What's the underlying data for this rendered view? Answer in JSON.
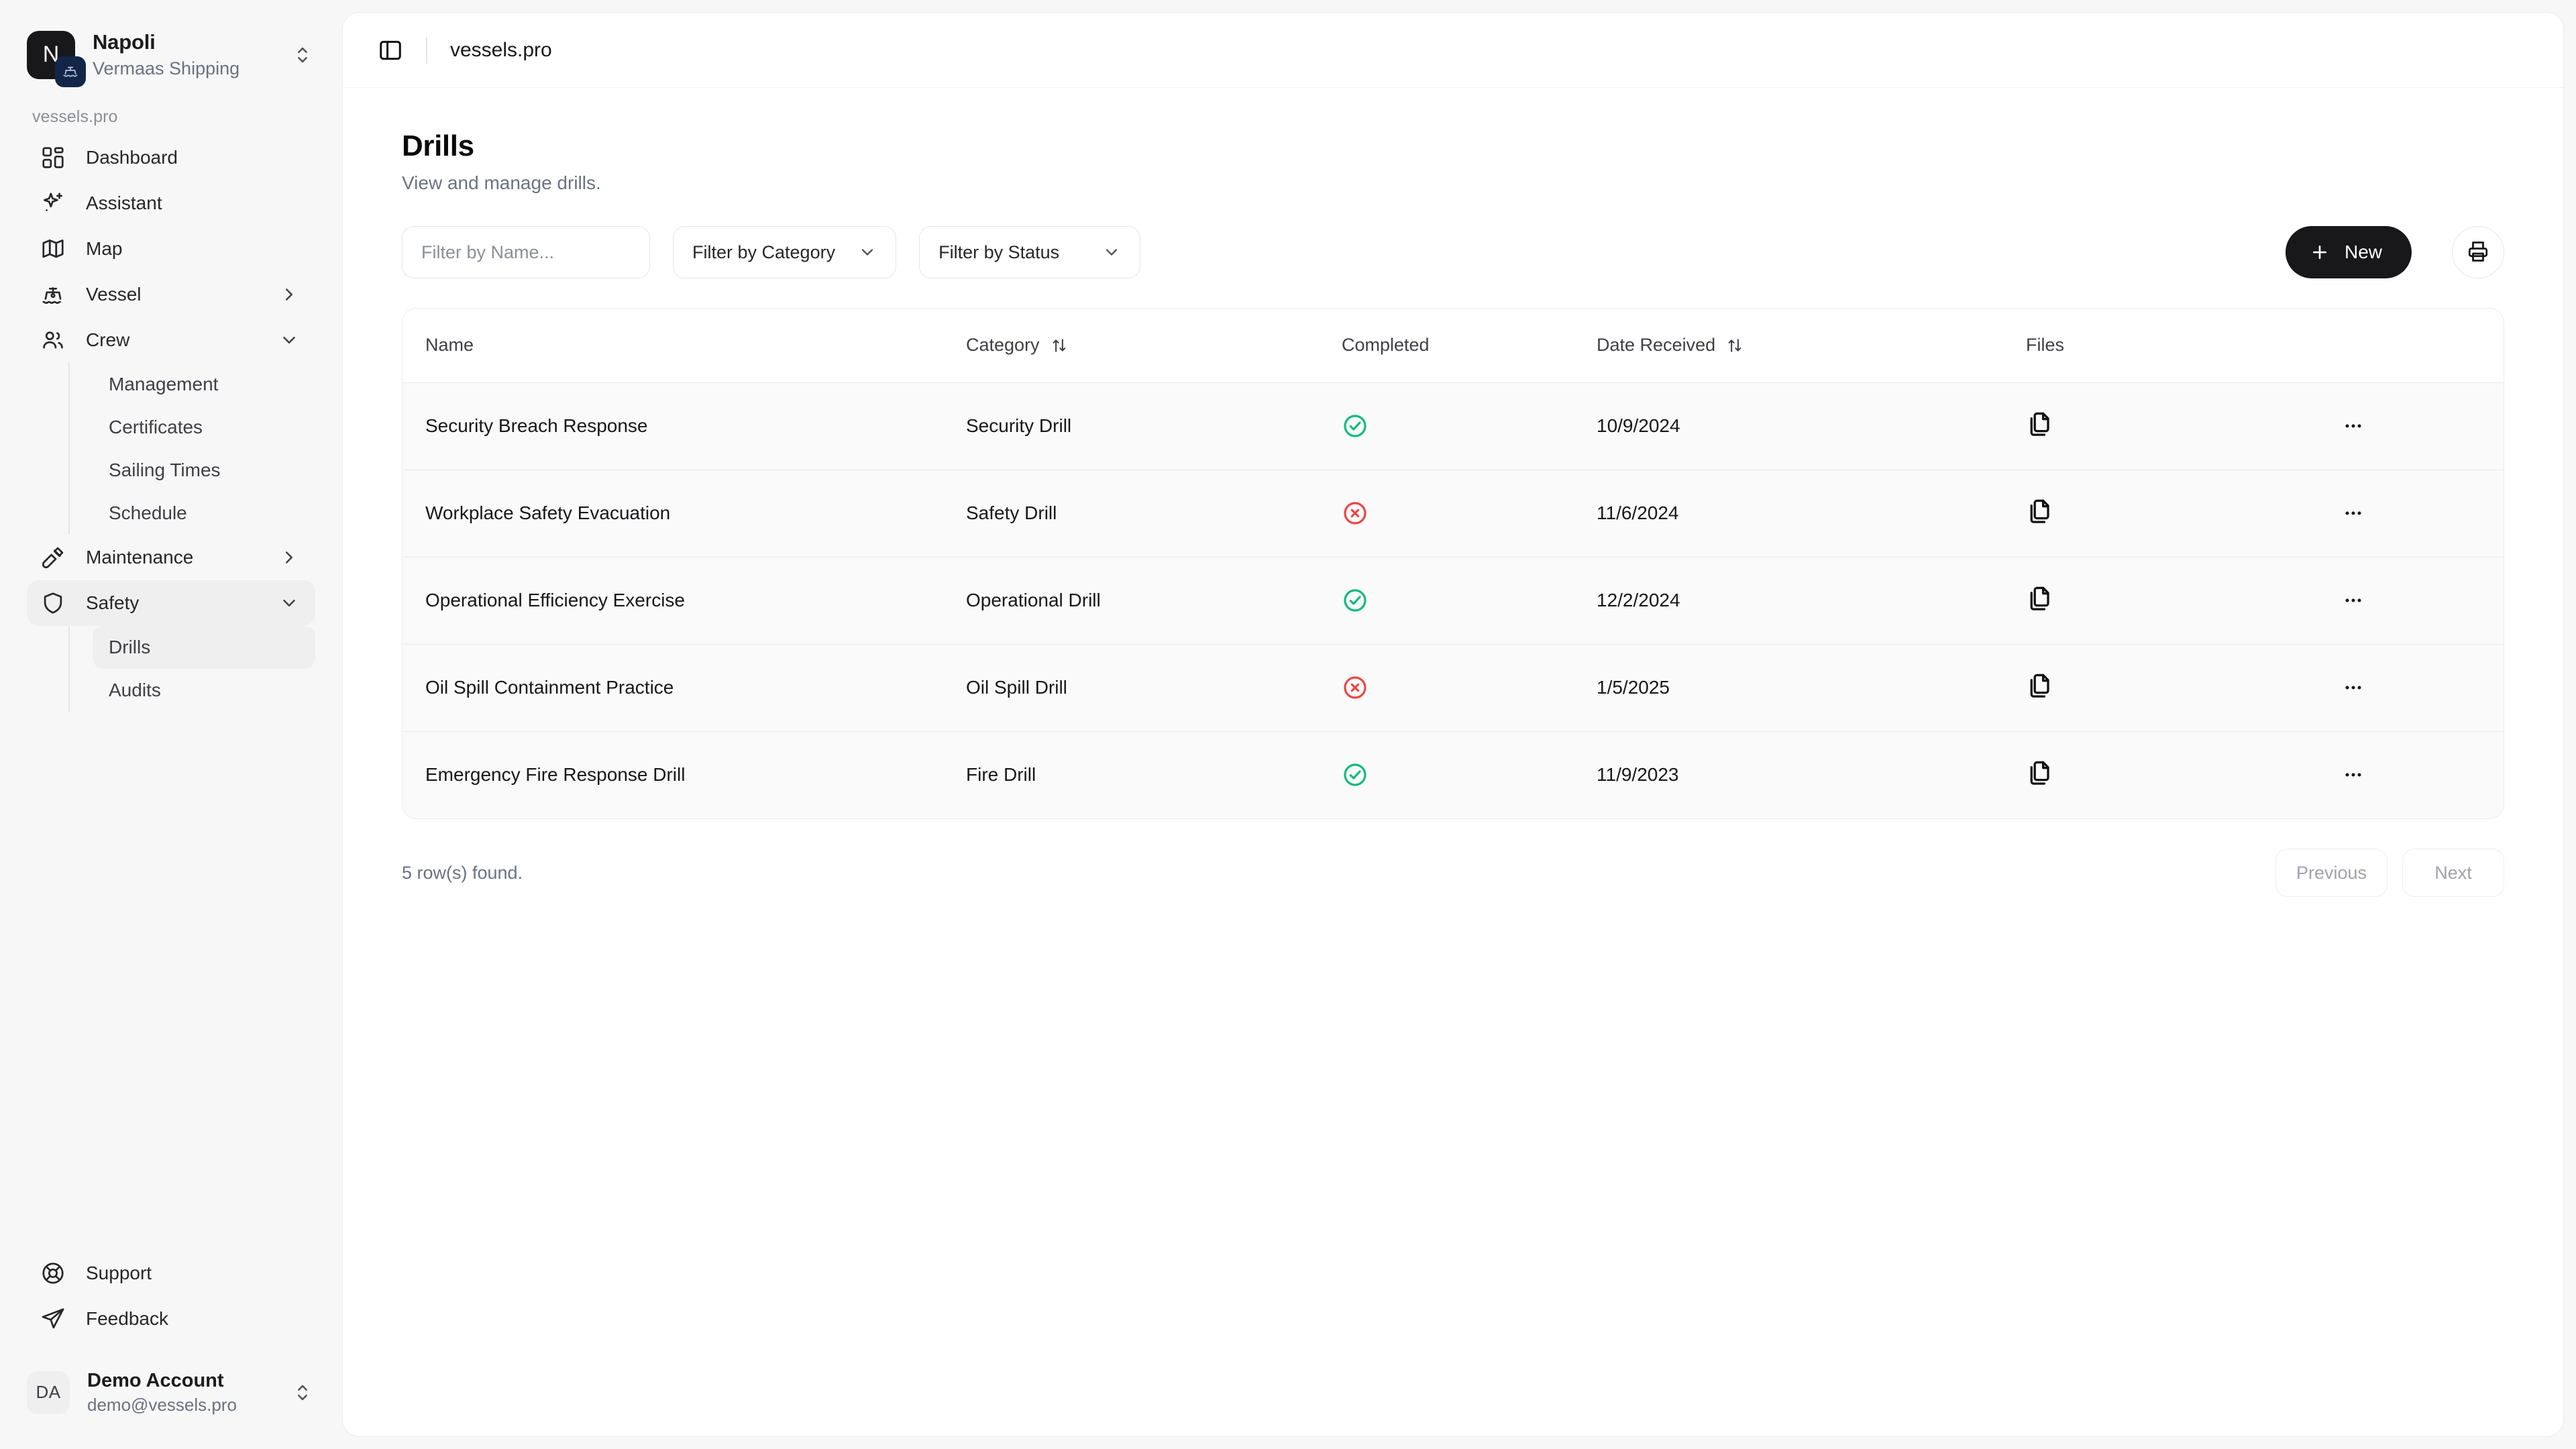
{
  "sidebar": {
    "org": {
      "initial": "N",
      "name": "Napoli",
      "subtitle": "Vermaas Shipping"
    },
    "section_label": "vessels.pro",
    "items": [
      {
        "label": "Dashboard",
        "icon": "grid-icon",
        "expandable": false
      },
      {
        "label": "Assistant",
        "icon": "sparkle-icon",
        "expandable": false
      },
      {
        "label": "Map",
        "icon": "map-icon",
        "expandable": false
      },
      {
        "label": "Vessel",
        "icon": "ship-icon",
        "expandable": true,
        "state": "collapsed"
      },
      {
        "label": "Crew",
        "icon": "users-icon",
        "expandable": true,
        "state": "expanded"
      }
    ],
    "crew_children": [
      "Management",
      "Certificates",
      "Sailing Times",
      "Schedule"
    ],
    "maintenance": {
      "label": "Maintenance",
      "icon": "tools-icon",
      "state": "collapsed"
    },
    "safety": {
      "label": "Safety",
      "icon": "shield-icon",
      "state": "expanded"
    },
    "safety_children": [
      "Drills",
      "Audits"
    ],
    "active_item": "Drills",
    "bottom_items": [
      {
        "label": "Support",
        "icon": "lifebuoy-icon"
      },
      {
        "label": "Feedback",
        "icon": "send-icon"
      }
    ],
    "user": {
      "initials": "DA",
      "name": "Demo Account",
      "email": "demo@vessels.pro"
    }
  },
  "topbar": {
    "toggle_icon": "sidebar-toggle-icon",
    "breadcrumb": "vessels.pro"
  },
  "page": {
    "title": "Drills",
    "subtitle": "View and manage drills."
  },
  "toolbar": {
    "name_filter_value": "",
    "name_filter_placeholder": "Filter by Name...",
    "category_filter_label": "Filter by Category",
    "status_filter_label": "Filter by Status",
    "new_button_label": "New",
    "print_button_label": "Print"
  },
  "table": {
    "columns": [
      {
        "key": "name",
        "label": "Name",
        "sortable": false
      },
      {
        "key": "category",
        "label": "Category",
        "sortable": true
      },
      {
        "key": "completed",
        "label": "Completed",
        "sortable": false
      },
      {
        "key": "date_received",
        "label": "Date Received",
        "sortable": true
      },
      {
        "key": "files",
        "label": "Files",
        "sortable": false
      },
      {
        "key": "actions",
        "label": "",
        "sortable": false
      }
    ],
    "rows": [
      {
        "name": "Security Breach Response",
        "category": "Security Drill",
        "completed": true,
        "date_received": "10/9/2024"
      },
      {
        "name": "Workplace Safety Evacuation",
        "category": "Safety Drill",
        "completed": false,
        "date_received": "11/6/2024"
      },
      {
        "name": "Operational Efficiency Exercise",
        "category": "Operational Drill",
        "completed": true,
        "date_received": "12/2/2024"
      },
      {
        "name": "Oil Spill Containment Practice",
        "category": "Oil Spill Drill",
        "completed": false,
        "date_received": "1/5/2025"
      },
      {
        "name": "Emergency Fire Response Drill",
        "category": "Fire Drill",
        "completed": true,
        "date_received": "11/9/2023"
      }
    ],
    "row_count_text": "5 row(s) found.",
    "previous_label": "Previous",
    "next_label": "Next"
  },
  "colors": {
    "accent": "#18181b",
    "completed_yes": "#10b981",
    "completed_no": "#ef4444",
    "panel": "#ffffff",
    "app_bg": "#f7f7f7",
    "row_bg": "#fafafa"
  }
}
